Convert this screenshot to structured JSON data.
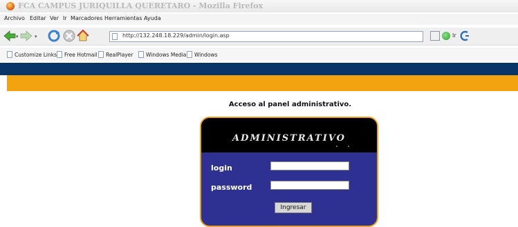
{
  "window": {
    "title": "FCA CAMPUS JURIQUILLA QUERETARO - Mozilla Firefox"
  },
  "menu": [
    "Archivo",
    "Editar",
    "Ver",
    "Ir",
    "Marcadores",
    "Herramientas",
    "Ayuda"
  ],
  "nav": {
    "url": "http://132.248.18.229/admin/login.asp",
    "go_label": "Ir"
  },
  "bookmarks": [
    "Customize Links",
    "Free Hotmail",
    "RealPlayer",
    "Windows Media",
    "Windows"
  ],
  "colors": {
    "header_blue": "#0a3569",
    "header_orange": "#f3a30f",
    "panel_blue": "#2f3192",
    "panel_border": "#f0a020"
  },
  "page": {
    "heading": "Acceso al panel administrativo.",
    "panel_title": "ADMINISTRATIVO",
    "login_label": "login",
    "password_label": "password",
    "login_value": "",
    "password_value": "",
    "submit_label": "Ingresar"
  }
}
